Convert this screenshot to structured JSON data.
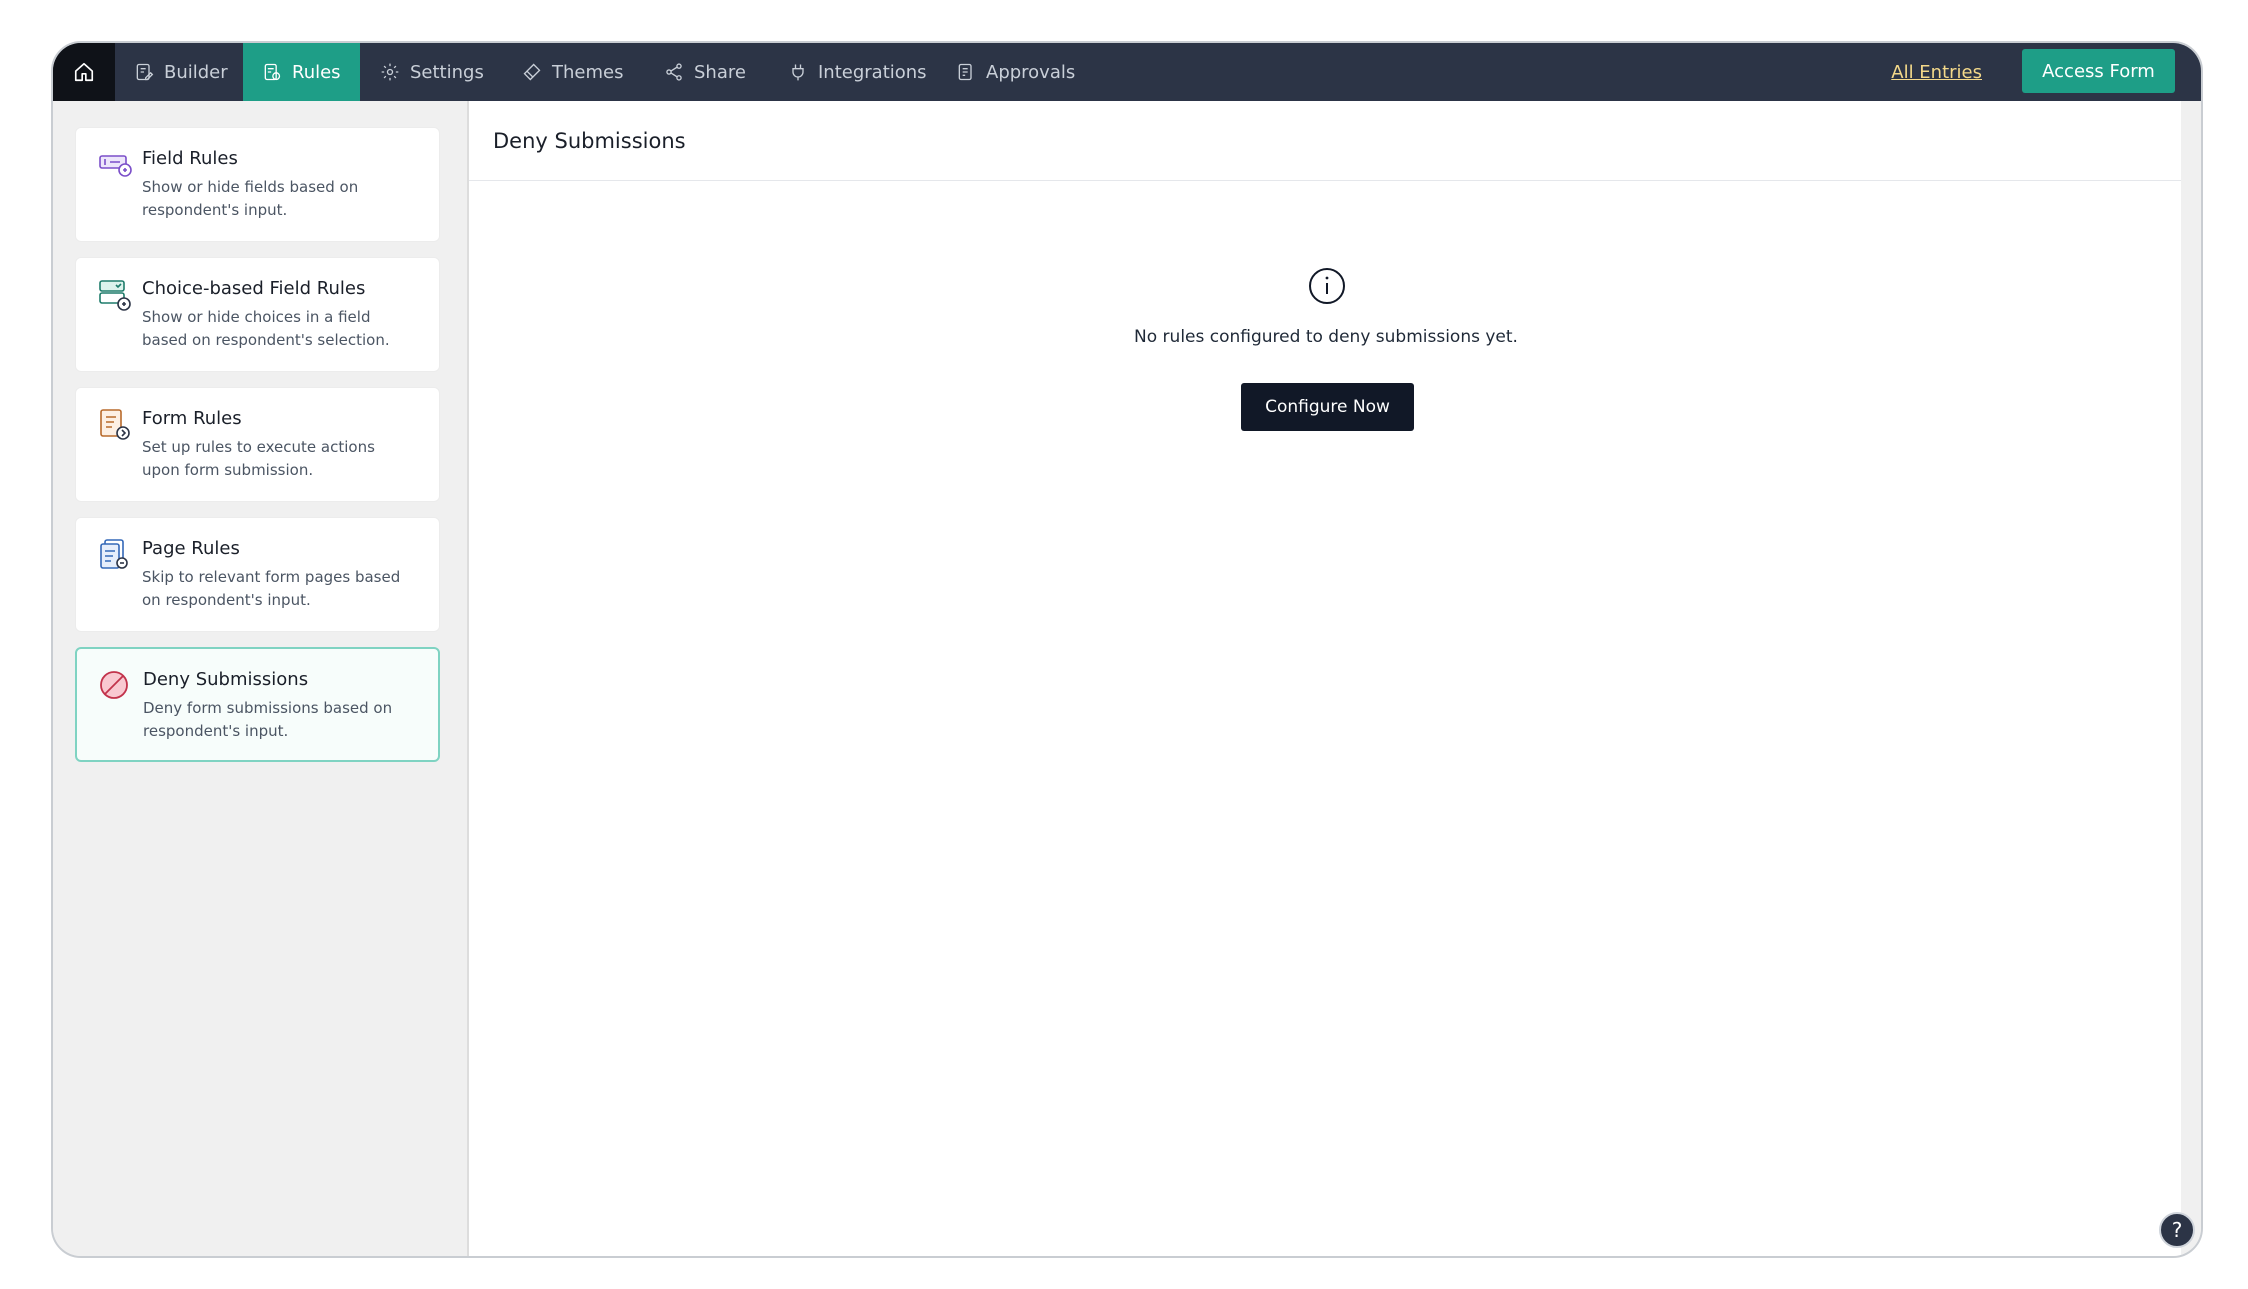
{
  "nav": {
    "tabs": [
      {
        "label": "Builder",
        "icon": "builder-icon"
      },
      {
        "label": "Rules",
        "icon": "rules-icon",
        "active": true
      },
      {
        "label": "Settings",
        "icon": "gear-icon"
      },
      {
        "label": "Themes",
        "icon": "brush-icon"
      },
      {
        "label": "Share",
        "icon": "share-icon"
      },
      {
        "label": "Integrations",
        "icon": "plug-icon"
      },
      {
        "label": "Approvals",
        "icon": "approvals-icon"
      }
    ],
    "all_entries": "All Entries",
    "access_form": "Access Form"
  },
  "sidebar": {
    "items": [
      {
        "title": "Field Rules",
        "desc": "Show or hide fields based on respondent's input."
      },
      {
        "title": "Choice-based Field Rules",
        "desc": "Show or hide choices in a field based on respondent's selection."
      },
      {
        "title": "Form Rules",
        "desc": "Set up rules to execute actions upon form submission."
      },
      {
        "title": "Page Rules",
        "desc": "Skip to relevant form pages based on respondent's input."
      },
      {
        "title": "Deny Submissions",
        "desc": "Deny form submissions based on respondent's input.",
        "active": true
      }
    ]
  },
  "main": {
    "title": "Deny Submissions",
    "empty_text": "No rules configured to deny submissions yet.",
    "configure_label": "Configure Now"
  },
  "help": "?",
  "colors": {
    "nav_bg": "#2c3446",
    "accent": "#1e9e87",
    "link": "#f4d98a",
    "button_dark": "#111827"
  }
}
